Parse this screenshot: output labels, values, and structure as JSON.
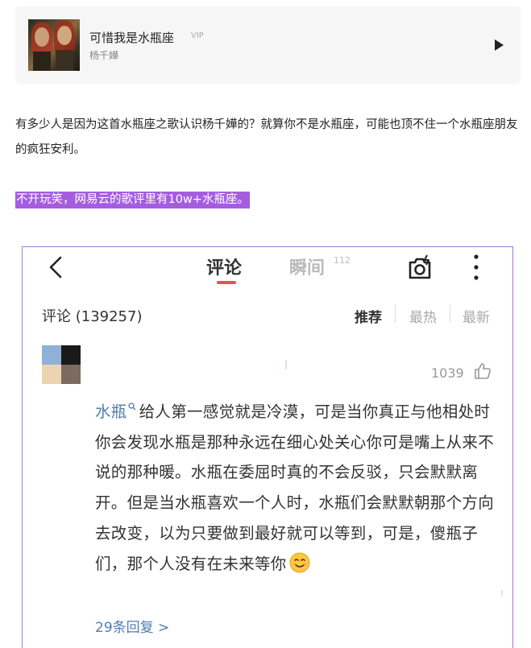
{
  "music_card": {
    "song_title": "可惜我是水瓶座",
    "vip_label": "VIP",
    "artist": "杨千嬅"
  },
  "article": {
    "paragraph": "有多少人是因为这首水瓶座之歌认识杨千嬅的？就算你不是水瓶座，可能也顶不住一个水瓶座朋友的疯狂安利。",
    "highlight": "不开玩笑，网易云的歌评里有10w+水瓶座。"
  },
  "screenshot": {
    "tabs": {
      "comments": "评论",
      "moments": "瞬间",
      "moments_count": "112"
    },
    "comments_header": "评论 (139257)",
    "sort": {
      "recommended": "推荐",
      "hottest": "最热",
      "newest": "最新"
    },
    "comment": {
      "like_count": "1039",
      "mention": "水瓶",
      "text": "给人第一感觉就是冷漠，可是当你真正与他相处时你会发现水瓶是那种永远在细心处关心你可是嘴上从来不说的那种暖。水瓶在委屈时真的不会反驳，只会默默离开。但是当水瓶喜欢一个人时，水瓶们会默默朝那个方向去改变，以为只要做到最好就可以等到，可是，傻瓶子们，那个人没有在未来等你",
      "replies": "29条回复 >"
    },
    "avatar_colors": [
      "#8fb0d8",
      "#1a1a1a",
      "#ecd4b0",
      "#7a6a60"
    ]
  },
  "colors": {
    "highlight_bg": "#a55de0",
    "tab_underline": "#e8505b",
    "link": "#507daf",
    "frame_border": "#a576d8"
  },
  "icons": {
    "play": "play-icon",
    "back": "back-arrow-icon",
    "camera": "camera-icon",
    "more": "more-vertical-icon",
    "like": "thumbs-up-icon",
    "search": "search-icon",
    "emoji": "smiley-emoji-icon"
  }
}
